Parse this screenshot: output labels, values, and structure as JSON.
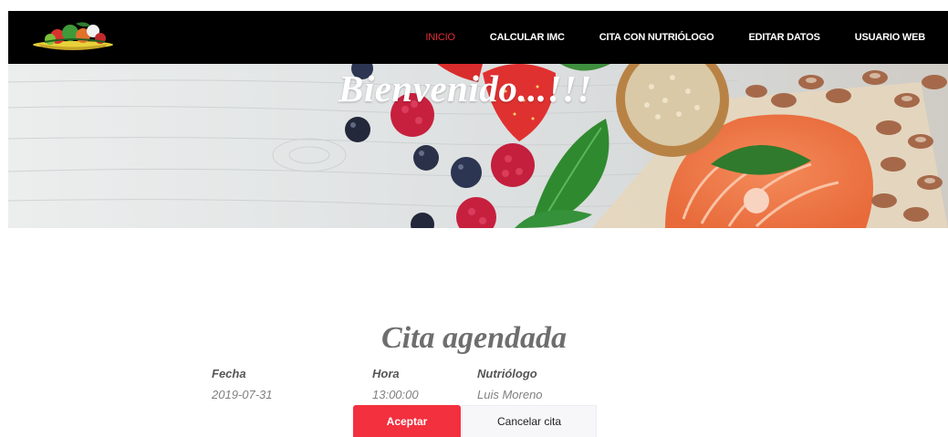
{
  "navbar": {
    "logo_icon": "fruit-basket-logo",
    "links": [
      {
        "label": "INICIO",
        "active": true
      },
      {
        "label": "CALCULAR IMC",
        "active": false
      },
      {
        "label": "CITA CON NUTRIÓLOGO",
        "active": false
      },
      {
        "label": "EDITAR DATOS",
        "active": false
      },
      {
        "label": "USUARIO WEB",
        "active": false
      }
    ],
    "active_color": "#e52b36",
    "background": "#000000"
  },
  "hero": {
    "title": "Bienvenido...!!!"
  },
  "appointment": {
    "title": "Cita agendada",
    "columns": {
      "fecha_label": "Fecha",
      "hora_label": "Hora",
      "nutriologo_label": "Nutriólogo"
    },
    "values": {
      "fecha": "2019-07-31",
      "hora": "13:00:00",
      "nutriologo": "Luis Moreno"
    },
    "accept_label": "Aceptar",
    "cancel_label": "Cancelar cita",
    "accept_color": "#f3303e"
  }
}
